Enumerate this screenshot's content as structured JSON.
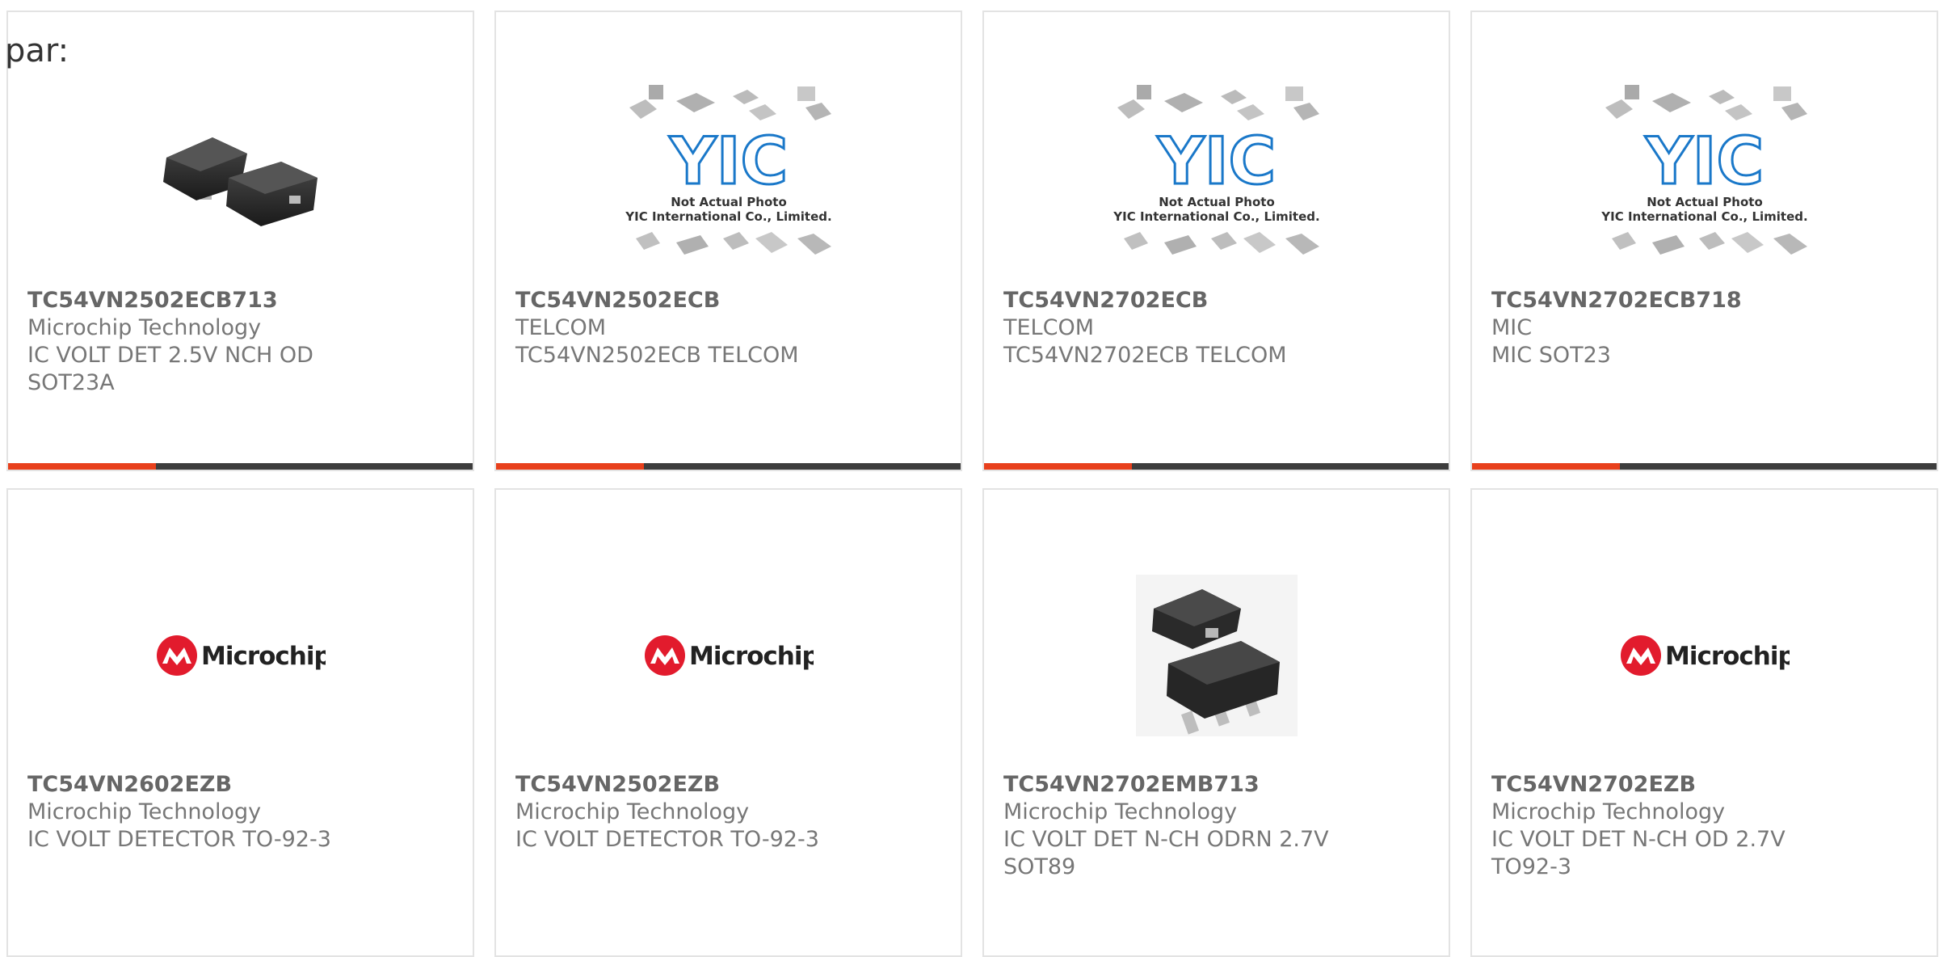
{
  "prefix_text": "par:",
  "placeholder": {
    "line1": "Not Actual Photo",
    "line2": "YIC International Co., Limited.",
    "logo_text": "YIC"
  },
  "brand_logo_text": "Microchip",
  "colors": {
    "accent": "#e8401c",
    "bar_dark": "#3d3d3d",
    "card_border": "#e3e3e3",
    "microchip_red": "#e21b2d",
    "yic_blue": "#1a78c9"
  },
  "products": [
    {
      "part_number": "TC54VN2502ECB713",
      "manufacturer": "Microchip Technology",
      "description": [
        "IC VOLT DET 2.5V NCH OD",
        "SOT23A"
      ],
      "image": "sot23-chip-photo"
    },
    {
      "part_number": "TC54VN2502ECB",
      "manufacturer": "TELCOM",
      "description": [
        "TC54VN2502ECB TELCOM"
      ],
      "image": "yic-placeholder"
    },
    {
      "part_number": "TC54VN2702ECB",
      "manufacturer": "TELCOM",
      "description": [
        "TC54VN2702ECB TELCOM"
      ],
      "image": "yic-placeholder"
    },
    {
      "part_number": "TC54VN2702ECB718",
      "manufacturer": "MIC",
      "description": [
        "MIC SOT23"
      ],
      "image": "yic-placeholder"
    },
    {
      "part_number": "TC54VN2602EZB",
      "manufacturer": "Microchip Technology",
      "description": [
        "IC VOLT DETECTOR TO-92-3"
      ],
      "image": "microchip-logo"
    },
    {
      "part_number": "TC54VN2502EZB",
      "manufacturer": "Microchip Technology",
      "description": [
        "IC VOLT DETECTOR TO-92-3"
      ],
      "image": "microchip-logo"
    },
    {
      "part_number": "TC54VN2702EMB713",
      "manufacturer": "Microchip Technology",
      "description": [
        "IC VOLT DET N-CH ODRN 2.7V",
        "SOT89"
      ],
      "image": "sot89-chip-photo"
    },
    {
      "part_number": "TC54VN2702EZB",
      "manufacturer": "Microchip Technology",
      "description": [
        "IC VOLT DET N-CH OD 2.7V",
        "TO92-3"
      ],
      "image": "microchip-logo"
    }
  ]
}
